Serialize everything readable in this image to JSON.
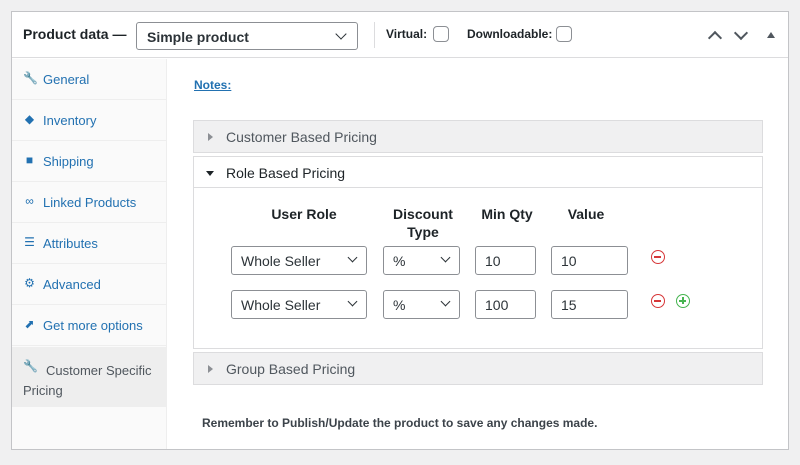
{
  "header": {
    "title": "Product data —",
    "product_type": "Simple product",
    "virtual_label": "Virtual:",
    "downloadable_label": "Downloadable:"
  },
  "sidebar": {
    "items": [
      {
        "label": "General",
        "icon": "wrench-icon"
      },
      {
        "label": "Inventory",
        "icon": "tag-icon"
      },
      {
        "label": "Shipping",
        "icon": "truck-icon"
      },
      {
        "label": "Linked Products",
        "icon": "link-icon"
      },
      {
        "label": "Attributes",
        "icon": "list-icon"
      },
      {
        "label": "Advanced",
        "icon": "gear-icon"
      },
      {
        "label": "Get more options",
        "icon": "plugin-icon"
      },
      {
        "label": "Customer Specific Pricing",
        "icon": "wrench-icon"
      }
    ]
  },
  "main": {
    "notes_link": "Notes:",
    "sections": [
      {
        "label": "Customer Based Pricing",
        "expanded": false
      },
      {
        "label": "Role Based Pricing",
        "expanded": true
      },
      {
        "label": "Group Based Pricing",
        "expanded": false
      }
    ],
    "role_table": {
      "headers": [
        "User Role",
        "Discount Type",
        "Min Qty",
        "Value"
      ],
      "rows": [
        {
          "role": "Whole Seller",
          "discount_type": "%",
          "min_qty": "10",
          "value": "10"
        },
        {
          "role": "Whole Seller",
          "discount_type": "%",
          "min_qty": "100",
          "value": "15"
        }
      ]
    },
    "footer_note": "Remember to Publish/Update the product to save any changes made."
  },
  "colors": {
    "link": "#2271b1",
    "remove": "#d63638",
    "add": "#46b450",
    "border": "#dcdcde"
  }
}
